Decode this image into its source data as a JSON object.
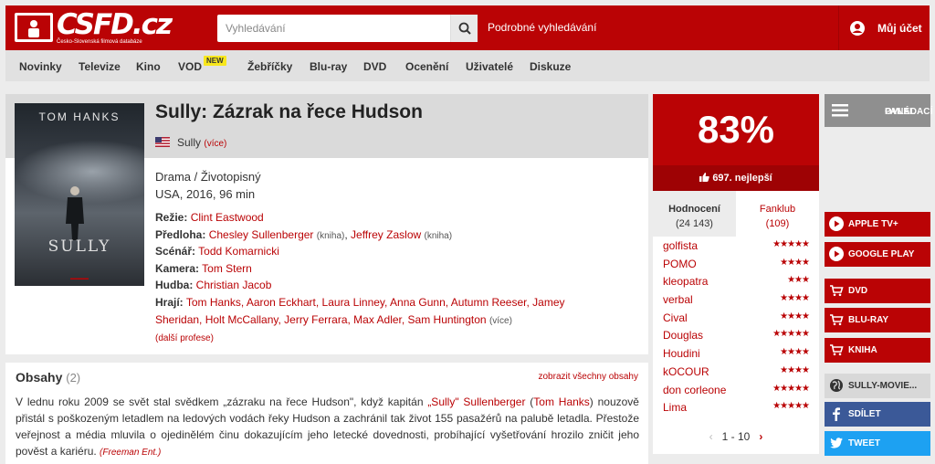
{
  "header": {
    "logo_text": "CSFD.cz",
    "logo_subtitle": "Česko-Slovenská filmová databáze",
    "search_placeholder": "Vyhledávání",
    "advanced_search": "Podrobné vyhledávání",
    "account": "Můj účet",
    "brand_color": "#ba0305"
  },
  "nav": {
    "items": [
      "Novinky",
      "Televize",
      "Kino",
      "VOD",
      "Žebříčky",
      "Blu-ray",
      "DVD",
      "Ocenění",
      "Uživatelé",
      "Diskuze"
    ],
    "new_badge": "NEW"
  },
  "poster": {
    "actor": "TOM HANKS",
    "title": "SULLY"
  },
  "film": {
    "title": "Sully: Zázrak na řece Hudson",
    "original_title": "Sully",
    "more": "(více)",
    "genre": "Drama / Životopisný",
    "origin": "USA, 2016, 96 min",
    "directing_label": "Režie:",
    "director": "Clint Eastwood",
    "source_label": "Předloha:",
    "source_1": "Chesley Sullenberger",
    "source_1_note": "(kniha)",
    "source_2": "Jeffrey Zaslow",
    "source_2_note": "(kniha)",
    "writer_label": "Scénář:",
    "writer": "Todd Komarnicki",
    "camera_label": "Kamera:",
    "camera": "Tom Stern",
    "music_label": "Hudba:",
    "music": "Christian Jacob",
    "cast_label": "Hrají:",
    "cast_line_1": "Tom Hanks, Aaron Eckhart, Laura Linney, Anna Gunn, Autumn Reeser, Jamey",
    "cast_line_2": "Sheridan, Holt McCallany, Jerry Ferrara, Max Adler, Sam Huntington",
    "cast_more": "(více)",
    "other_professions": "(další profese)"
  },
  "synopsis": {
    "title": "Obsahy",
    "count": "(2)",
    "show_all": "zobrazit všechny obsahy",
    "text_1": "V lednu roku 2009 se svět stal svědkem „zázraku na řece Hudson\", když kapitán ",
    "link_1": "„Sully\" Sullenberger",
    "text_2": " (",
    "link_2": "Tom Hanks",
    "text_3": ") nouzově přistál s poškozeným letadlem na ledových vodách řeky Hudson a zachránil tak život 155 pasažérů na palubě letadla. Přestože veřejnost a média mluvila o ojedinělém činu dokazujícím jeho letecké dovednosti, probíhající vyšetřování hrozilo zničit jeho pověst a kariéru. ",
    "source": "(Freeman Ent.)"
  },
  "rating": {
    "percent": "83%",
    "best": "697. nejlepší",
    "tab_ratings": "Hodnocení",
    "ratings_count": "(24 143)",
    "tab_fanclub": "Fanklub",
    "fanclub_count": "(109)",
    "users": [
      {
        "name": "golfista",
        "stars": "★★★★★"
      },
      {
        "name": "POMO",
        "stars": "★★★★"
      },
      {
        "name": "kleopatra",
        "stars": "★★★"
      },
      {
        "name": "verbal",
        "stars": "★★★★"
      },
      {
        "name": "Cival",
        "stars": "★★★★"
      },
      {
        "name": "Douglas",
        "stars": "★★★★★"
      },
      {
        "name": "Houdini",
        "stars": "★★★★"
      },
      {
        "name": "kOCOUR",
        "stars": "★★★★"
      },
      {
        "name": "don corleone",
        "stars": "★★★★★"
      },
      {
        "name": "Lima",
        "stars": "★★★★★"
      }
    ],
    "pager": "1 - 10"
  },
  "sidebar": {
    "control_panel": [
      "OVLÁDACÍ",
      "PANEL"
    ],
    "apple_tv": "APPLE TV+",
    "google_play": "GOOGLE PLAY",
    "dvd": "DVD",
    "bluray": "BLU-RAY",
    "book": "KNIHA",
    "website": "SULLY-MOVIE...",
    "share": "SDÍLET",
    "tweet": "TWEET"
  }
}
